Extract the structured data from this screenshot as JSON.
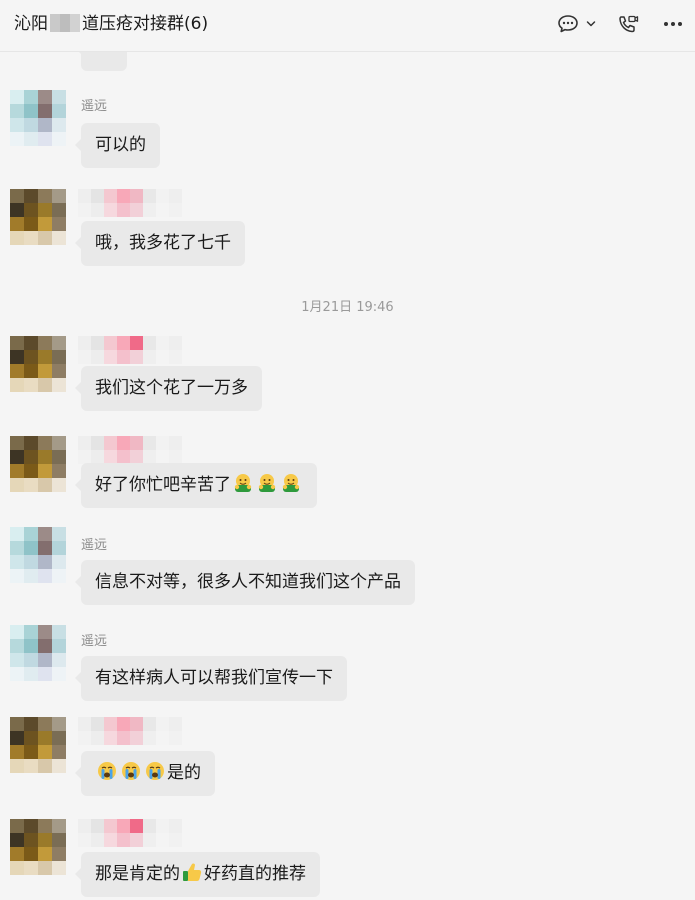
{
  "header": {
    "title_prefix": "沁阳",
    "title_suffix": "道压疮对接群(6)",
    "icons": [
      "chat-bubble-icon",
      "chevron-down-icon",
      "video-call-icon",
      "more-icon"
    ]
  },
  "messages": [
    {
      "sender": "",
      "text": "",
      "partial": true
    },
    {
      "sender": "遥远",
      "text": "可以的",
      "avatar_style": "light"
    },
    {
      "sender": "",
      "text": "哦，我多花了七千",
      "avatar_style": "dark"
    },
    {
      "sender": "",
      "text": "我们这个花了一万多",
      "avatar_style": "dark"
    },
    {
      "sender": "",
      "text": "好了你忙吧辛苦了",
      "emoji": [
        "hug-emoji",
        "hug-emoji",
        "hug-emoji"
      ],
      "avatar_style": "dark"
    },
    {
      "sender": "遥远",
      "text": "信息不对等，很多人不知道我们这个产品",
      "avatar_style": "light"
    },
    {
      "sender": "遥远",
      "text": "有这样病人可以帮我们宣传一下",
      "avatar_style": "light"
    },
    {
      "sender": "",
      "text": "是的",
      "emoji_before": [
        "crying-emoji",
        "crying-emoji",
        "crying-emoji"
      ],
      "avatar_style": "dark"
    },
    {
      "sender": "",
      "text_before": "那是肯定的",
      "emoji_mid": [
        "thumbs-up-emoji"
      ],
      "text_after": "好药直的推荐",
      "avatar_style": "dark"
    }
  ],
  "timestamp": "1月21日 19:46",
  "colors": {
    "background": "#f5f5f5",
    "bubble": "#e9e9e9",
    "sender": "#8a8a8a"
  }
}
